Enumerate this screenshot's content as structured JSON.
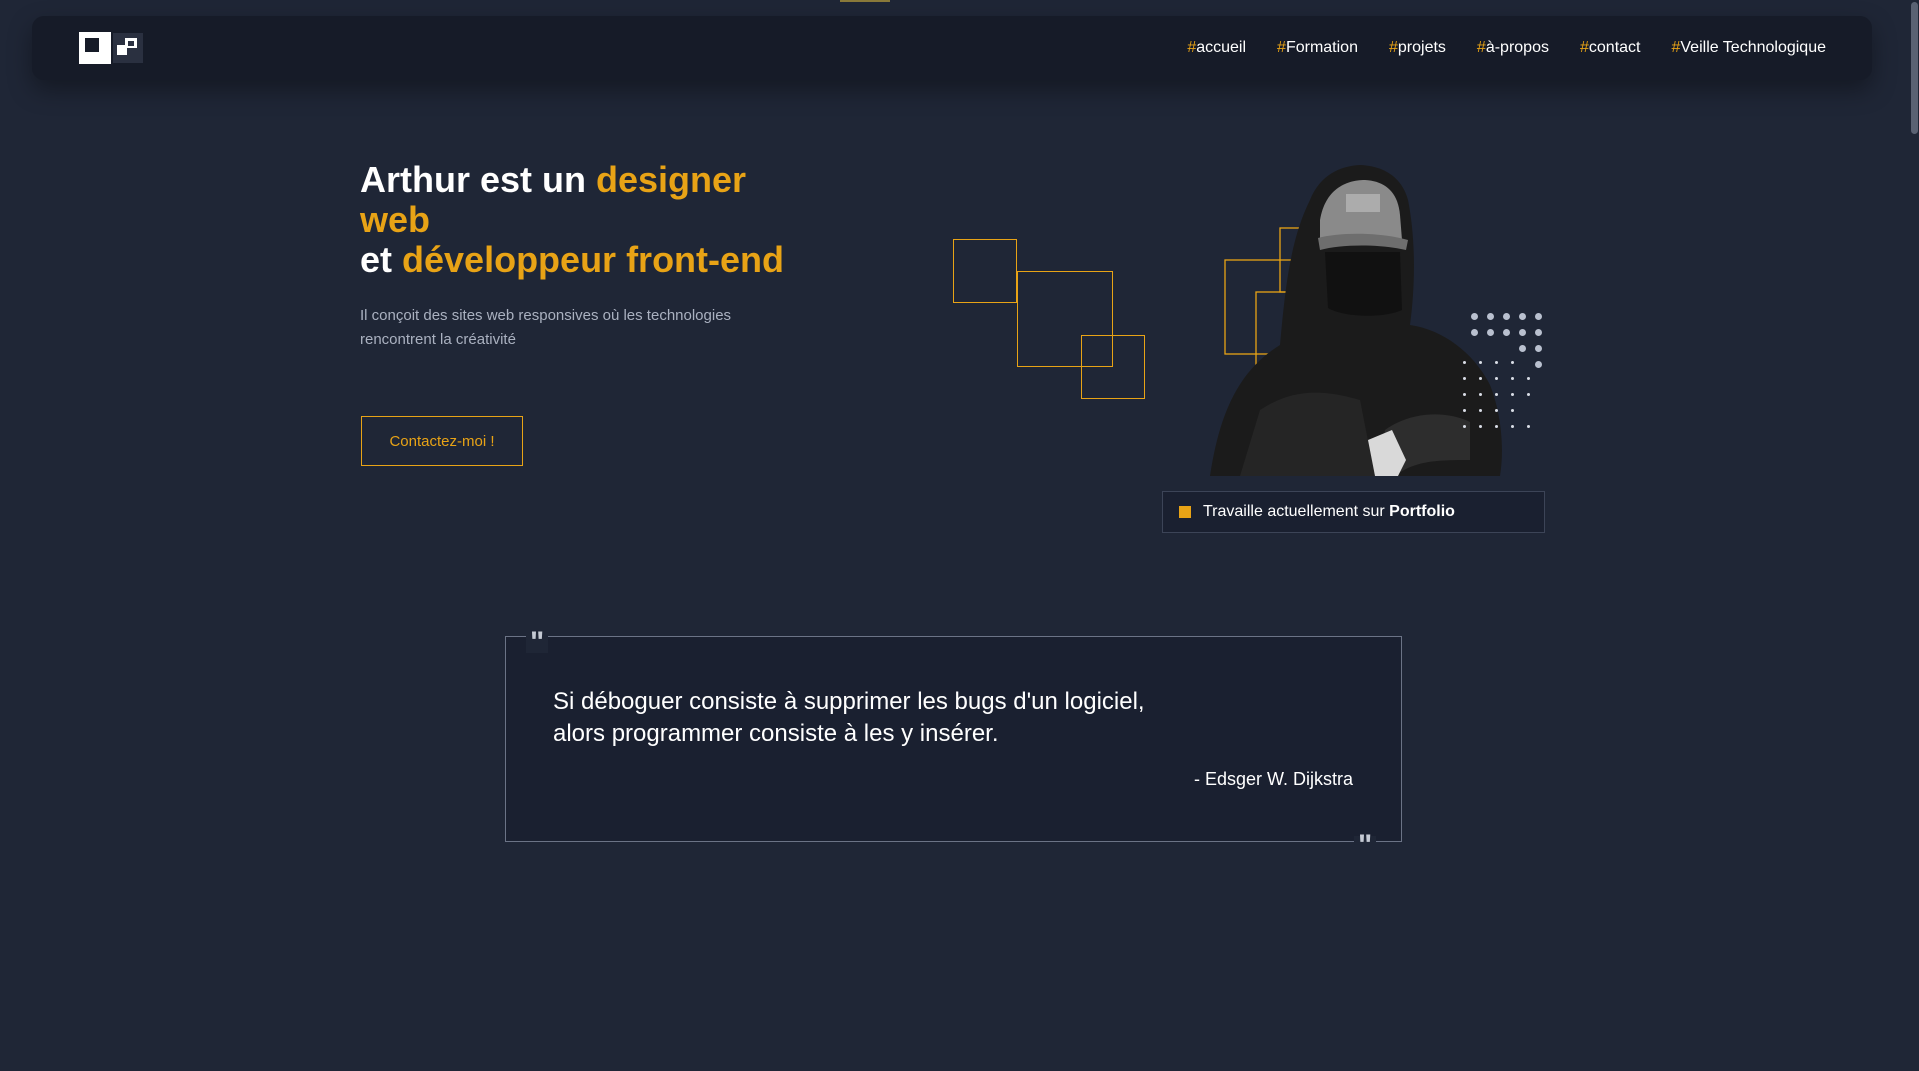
{
  "header": {
    "nav": [
      {
        "hash": "#",
        "label": "accueil"
      },
      {
        "hash": "#",
        "label": "Formation"
      },
      {
        "hash": "#",
        "label": "projets"
      },
      {
        "hash": "#",
        "label": "à-propos"
      },
      {
        "hash": "#",
        "label": "contact"
      },
      {
        "hash": "#",
        "label": "Veille Technologique"
      }
    ]
  },
  "hero": {
    "title_part1": "Arthur est un ",
    "title_accent1": "designer web",
    "title_part2": "et ",
    "title_accent2": "développeur front-end",
    "subtitle": "Il conçoit des sites web responsives où les technologies rencontrent la créativité",
    "cta_label": "Contactez-moi !"
  },
  "status": {
    "prefix": "Travaille actuellement sur ",
    "project": "Portfolio"
  },
  "quote": {
    "open_mark": "\"",
    "close_mark": "\"",
    "line1": "Si déboguer consiste à supprimer les bugs d'un logiciel,",
    "line2": "alors programmer consiste à les y insérer.",
    "author": "- Edsger W. Dijkstra"
  },
  "colors": {
    "background": "#1f2636",
    "accent": "#e8a316",
    "header_bg": "#161b28"
  }
}
